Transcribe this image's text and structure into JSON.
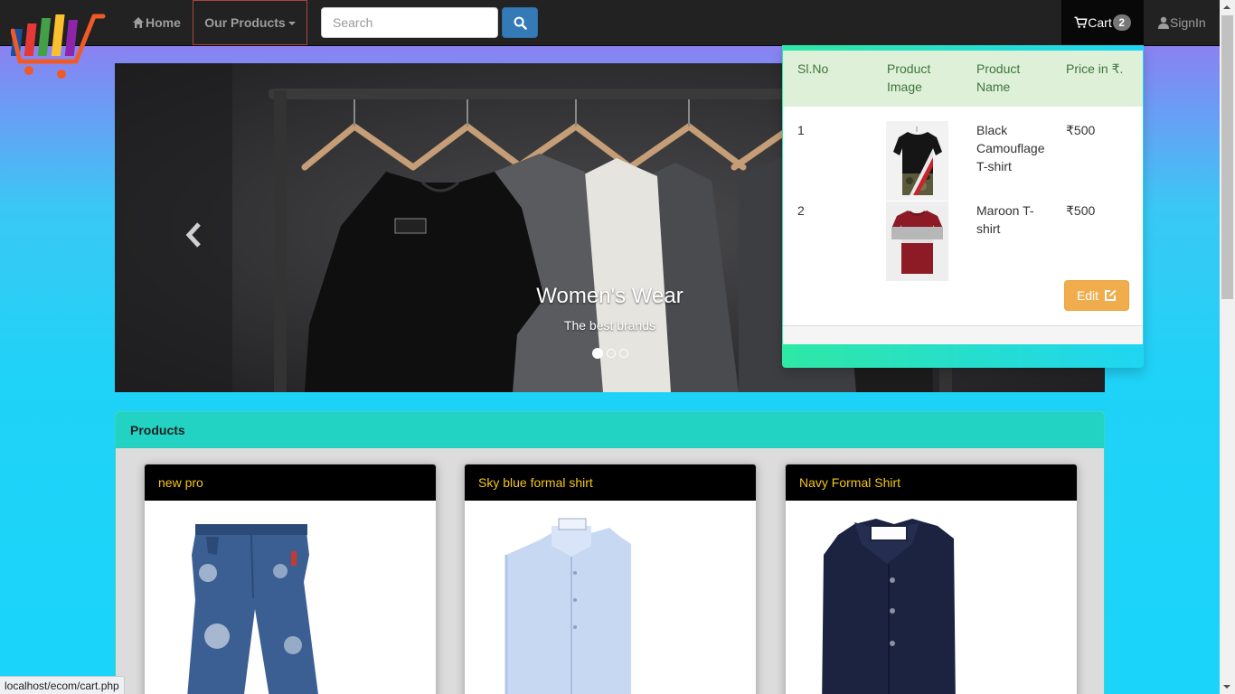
{
  "nav": {
    "home_label": "Home",
    "products_label": "Our Products",
    "search_placeholder": "Search",
    "cart_label": "Cart",
    "cart_count": "2",
    "signin_label": "SignIn"
  },
  "carousel": {
    "caption_title": "Women's Wear",
    "caption_sub": "The best brands",
    "slides": 3,
    "active_slide": 1
  },
  "cart": {
    "headers": {
      "sl": "Sl.No",
      "image": "Product Image",
      "name": "Product Name",
      "price": "Price in ₹."
    },
    "items": [
      {
        "sl": "1",
        "name": "Black Camouflage T-shirt",
        "price": "₹500",
        "image_icon": "black-camouflage-tshirt-image"
      },
      {
        "sl": "2",
        "name": "Maroon T-shirt",
        "price": "₹500",
        "image_icon": "maroon-tshirt-image"
      }
    ],
    "edit_label": "Edit"
  },
  "products": {
    "heading": "Products",
    "cards": [
      {
        "title": "new pro",
        "image_icon": "ripped-jeans-image"
      },
      {
        "title": "Sky blue formal shirt",
        "image_icon": "sky-blue-shirt-image"
      },
      {
        "title": "Navy Formal Shirt",
        "image_icon": "navy-shirt-image"
      }
    ]
  },
  "status_url": "localhost/ecom/cart.php",
  "colors": {
    "navbar": "#222222",
    "accent_blue": "#337ab7",
    "edit_orange": "#f0ad4e",
    "card_title": "#f5c518",
    "products_header": "#22d3c3"
  }
}
